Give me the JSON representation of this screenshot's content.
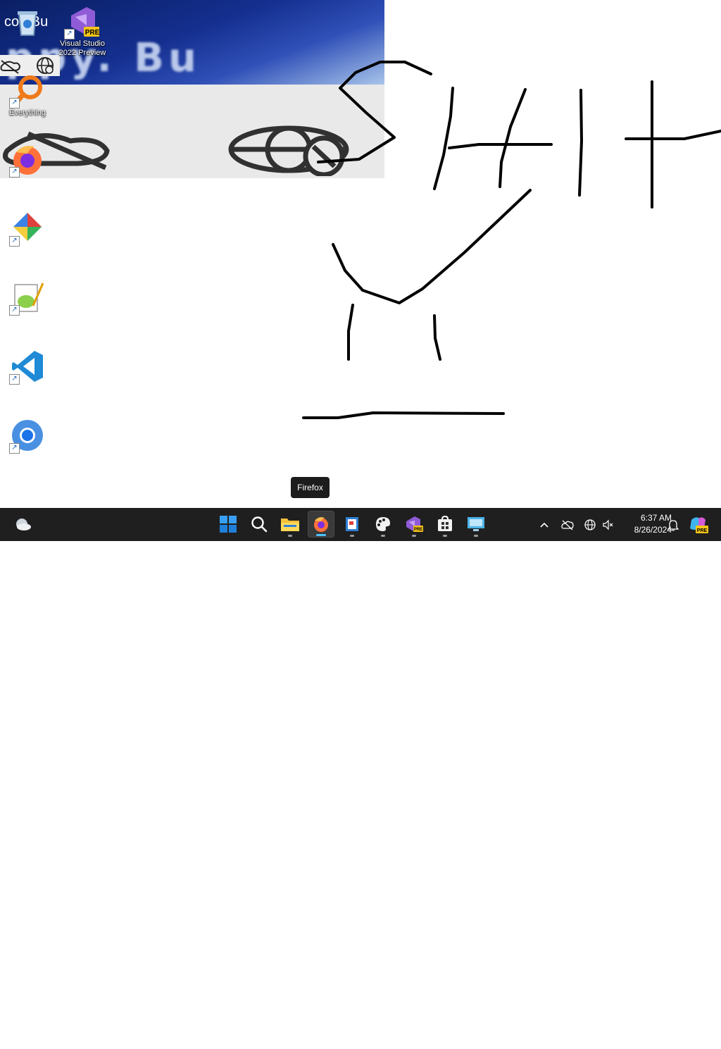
{
  "desktop_icons": [
    {
      "id": "recycle-bin",
      "icon": "recycle-bin-icon",
      "label": "",
      "shortcut": false
    },
    {
      "id": "visual-studio-2022-preview",
      "icon": "visual-studio-preview-icon",
      "label": "Visual Studio\n2022 Preview",
      "badge": "PRE",
      "shortcut": true
    },
    {
      "id": "everything",
      "icon": "everything-search-icon",
      "label": "Everything",
      "shortcut": true
    },
    {
      "id": "firefox",
      "icon": "firefox-icon",
      "label": "",
      "shortcut": true
    },
    {
      "id": "app",
      "icon": "app-icon",
      "label": "",
      "shortcut": true
    },
    {
      "id": "notepad-plus-plus",
      "icon": "notepad-plus-plus-icon",
      "label": "",
      "shortcut": true
    },
    {
      "id": "vscode",
      "icon": "vscode-icon",
      "label": "",
      "shortcut": true
    },
    {
      "id": "chrome",
      "icon": "chrome-icon",
      "label": "",
      "shortcut": true
    }
  ],
  "zoomed_overlay": {
    "text": "co.. Bu",
    "banner_text": "ppy.  Bu"
  },
  "tooltip": {
    "text": "Firefox"
  },
  "taskbar": {
    "widgets_icon": "weather-widget-icon",
    "apps": [
      {
        "name": "Start",
        "icon": "windows-start-icon",
        "running": false,
        "active": false
      },
      {
        "name": "Search",
        "icon": "search-icon",
        "running": false,
        "active": false
      },
      {
        "name": "File Explorer",
        "icon": "folder-icon",
        "running": true,
        "active": false
      },
      {
        "name": "Firefox",
        "icon": "firefox-icon",
        "running": true,
        "active": true
      },
      {
        "name": "Notebook",
        "icon": "notebook-icon",
        "running": true,
        "active": false
      },
      {
        "name": "Paint",
        "icon": "paint-palette-icon",
        "running": true,
        "active": false
      },
      {
        "name": "Visual Studio Preview",
        "icon": "visual-studio-preview-icon",
        "badge": "PRE",
        "running": true,
        "active": false
      },
      {
        "name": "Microsoft Store",
        "icon": "store-icon",
        "running": true,
        "active": false
      },
      {
        "name": "Remote Desktop",
        "icon": "remote-desktop-icon",
        "running": true,
        "active": false
      }
    ],
    "tray": {
      "icons": [
        "chevron-up-icon",
        "onedrive-offline-icon",
        "network-globe-icon",
        "volume-muted-icon"
      ],
      "time": "6:37 AM",
      "date": "8/26/2024",
      "notification_icon": "bell-icon",
      "copilot_badge": "PRE"
    }
  },
  "colors": {
    "canvas": "#ffffff",
    "taskbar": "#1f1f1f",
    "stroke": "#000000",
    "vs_purple": "#8f5bd6",
    "pre_badge": "#f5c518"
  }
}
